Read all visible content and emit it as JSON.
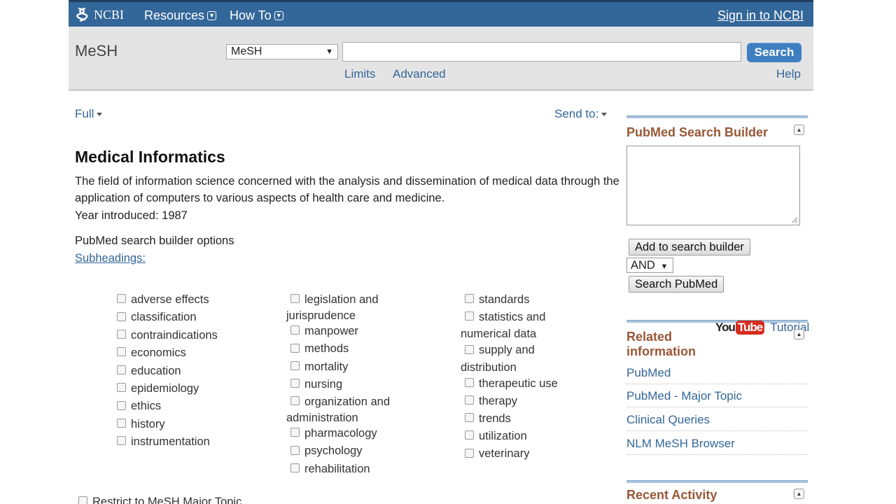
{
  "header": {
    "brand": "NCBI",
    "menus": [
      "Resources",
      "How To"
    ],
    "signin": "Sign in to NCBI"
  },
  "search": {
    "db_title": "MeSH",
    "db_selected": "MeSH",
    "term_value": "",
    "search_label": "Search",
    "links": [
      "Limits",
      "Advanced"
    ],
    "help": "Help"
  },
  "toolbar": {
    "format": "Full",
    "send_to": "Send to:"
  },
  "record": {
    "title": "Medical Informatics",
    "description": "The field of information science concerned with the analysis and dissemination of medical data through the application of computers to various aspects of health care and medicine.",
    "year": "Year introduced: 1987",
    "builder_options": "PubMed search builder options",
    "subheadings_label": "Subheadings:",
    "subheadings": {
      "col1": [
        "adverse effects",
        "classification",
        "contraindications",
        "economics",
        "education",
        "epidemiology",
        "ethics",
        "history",
        "instrumentation"
      ],
      "col2": [
        "legislation and",
        "jurisprudence",
        "manpower",
        "methods",
        "mortality",
        "nursing",
        "organization and",
        "administration",
        "pharmacology",
        "psychology",
        "rehabilitation"
      ],
      "col3": [
        "standards",
        "statistics and",
        "numerical data",
        "supply and",
        "distribution",
        "therapeutic use",
        "therapy",
        "trends",
        "utilization",
        "veterinary"
      ]
    },
    "restrict": "Restrict to MeSH Major Topic."
  },
  "sidebar": {
    "builder_title": "PubMed Search Builder",
    "builder_value": "",
    "add_button": "Add to search builder",
    "operator": "AND",
    "search_pubmed": "Search PubMed",
    "youtube_you": "You",
    "youtube_tube": "Tube",
    "tutorial": "Tutorial",
    "related_title_1": "Related",
    "related_title_2": "information",
    "related_links": [
      "PubMed",
      "PubMed - Major Topic",
      "Clinical Queries",
      "NLM MeSH Browser"
    ],
    "recent_title": "Recent Activity"
  },
  "colors": {
    "header_blue": "#336699",
    "link_blue": "#336699",
    "sidebar_title": "#985735",
    "search_button": "#3e7fc1"
  }
}
